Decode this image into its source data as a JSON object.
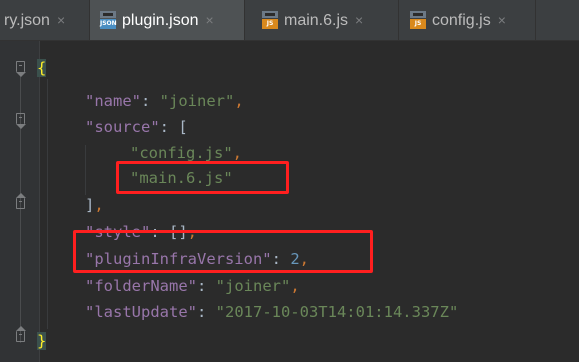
{
  "tabs": [
    {
      "label": "ry.json",
      "icon": "json-file-icon",
      "active": false
    },
    {
      "label": "plugin.json",
      "icon": "json-file-icon",
      "active": true
    },
    {
      "label": "main.6.js",
      "icon": "js-file-icon",
      "active": false
    },
    {
      "label": "config.js",
      "icon": "js-file-icon",
      "active": false
    }
  ],
  "tab_close_glyph": "×",
  "file_badges": {
    "json": "JSON",
    "js": "JS"
  },
  "code": {
    "open_brace": "{",
    "name_key": "\"name\"",
    "name_value": "\"joiner\"",
    "source_key": "\"source\"",
    "source_open": "[",
    "source_items": [
      "\"config.js\"",
      "\"main.6.js\""
    ],
    "source_close": "]",
    "style_key": "\"style\"",
    "style_value": "[]",
    "infra_key": "\"pluginInfraVersion\"",
    "infra_value": "2",
    "folder_key": "\"folderName\"",
    "folder_value": "\"joiner\"",
    "update_key": "\"lastUpdate\"",
    "update_value": "\"2017-10-03T14:01:14.337Z\"",
    "close_brace": "}",
    "colon": ": ",
    "comma": ","
  },
  "colors": {
    "background": "#2b2b2b",
    "key": "#9876aa",
    "string": "#6a8759",
    "number": "#6897bb",
    "punctuation": "#cc7832",
    "highlight_box": "#ff1f1f"
  }
}
